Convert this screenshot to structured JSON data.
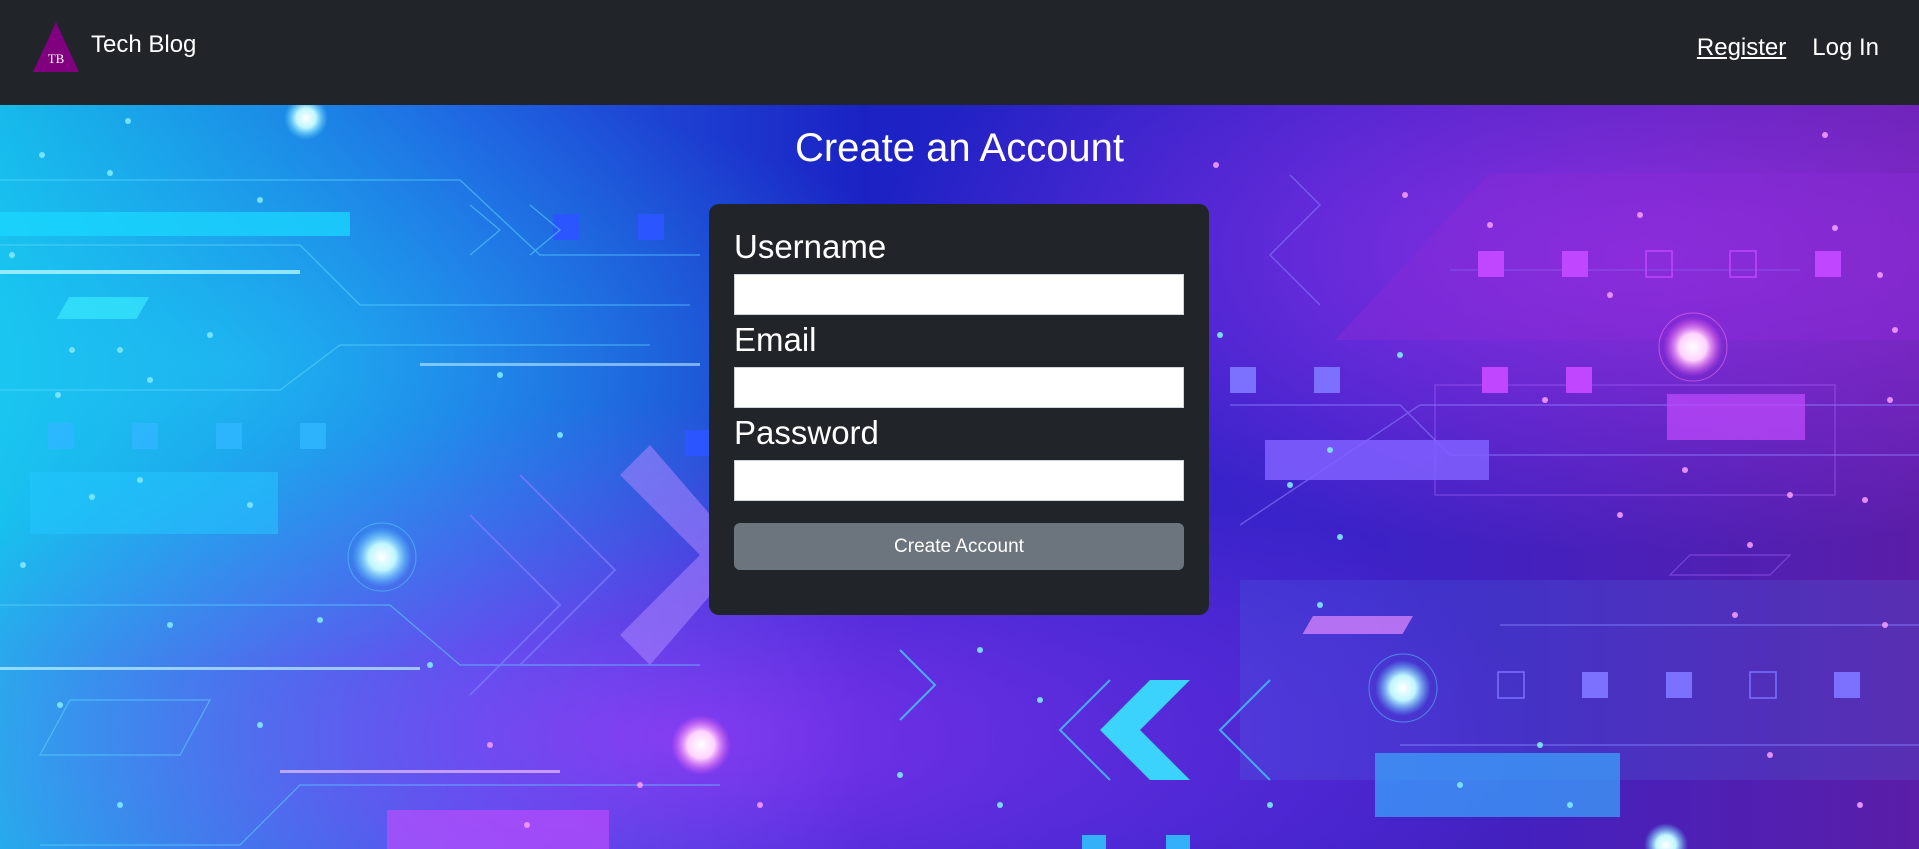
{
  "navbar": {
    "logo_text": "TB",
    "brand": "Tech Blog",
    "links": [
      {
        "label": "Register",
        "active": true
      },
      {
        "label": "Log In",
        "active": false
      }
    ]
  },
  "main": {
    "title": "Create an Account",
    "form": {
      "username_label": "Username",
      "username_value": "",
      "email_label": "Email",
      "email_value": "",
      "password_label": "Password",
      "password_value": "",
      "submit_label": "Create Account"
    }
  },
  "colors": {
    "navbar_bg": "#212529",
    "card_bg": "#212529",
    "button_bg": "#6c757d",
    "logo_purple": "#800080",
    "bg_cyan": "#22d3ff",
    "bg_blue": "#1e3ad8",
    "bg_magenta": "#b83cff"
  }
}
